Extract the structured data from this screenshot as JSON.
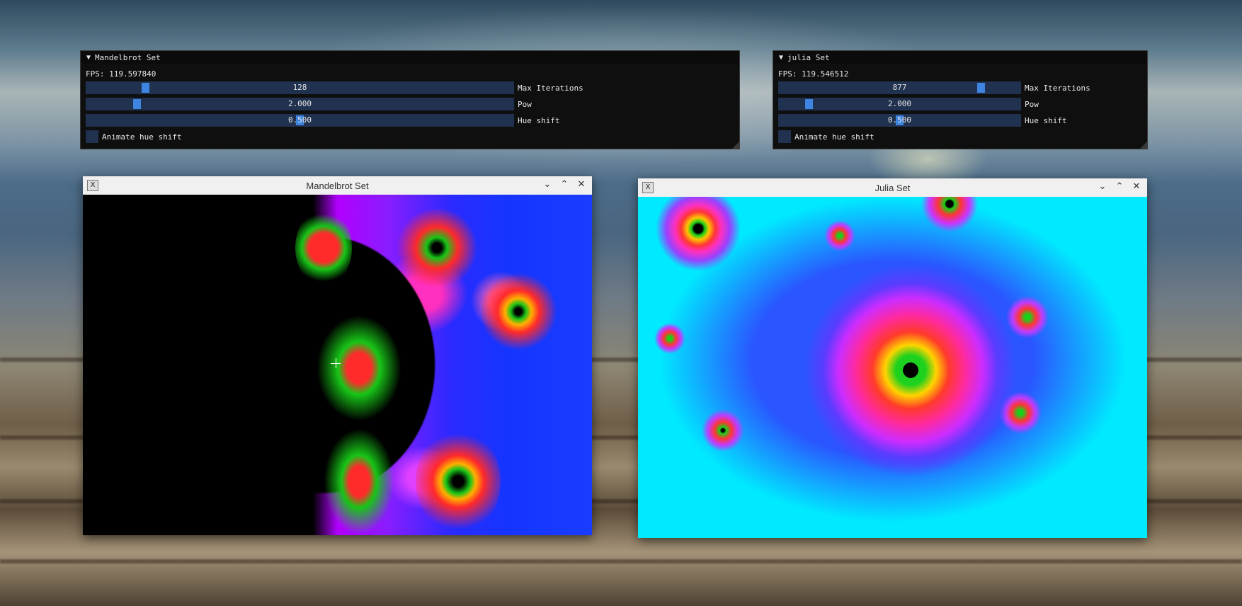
{
  "mandelbrot_panel": {
    "title": "Mandelbrot Set",
    "fps_text": "FPS: 119.597840",
    "sliders": [
      {
        "value_text": "128",
        "label": "Max Iterations",
        "fraction": 0.13
      },
      {
        "value_text": "2.000",
        "label": "Pow",
        "fraction": 0.11
      },
      {
        "value_text": "0.500",
        "label": "Hue shift",
        "fraction": 0.5
      }
    ],
    "checkbox_label": "Animate hue shift",
    "checkbox_checked": false
  },
  "julia_panel": {
    "title": "julia Set",
    "fps_text": "FPS: 119.546512",
    "sliders": [
      {
        "value_text": "877",
        "label": "Max Iterations",
        "fraction": 0.85
      },
      {
        "value_text": "2.000",
        "label": "Pow",
        "fraction": 0.11
      },
      {
        "value_text": "0.500",
        "label": "Hue shift",
        "fraction": 0.5
      }
    ],
    "checkbox_label": "Animate hue shift",
    "checkbox_checked": false
  },
  "mandelbrot_window": {
    "title": "Mandelbrot Set",
    "app_icon": "x-window-icon",
    "controls": [
      "minimize-icon",
      "maximize-icon",
      "close-icon"
    ]
  },
  "julia_window": {
    "title": "Julia Set",
    "app_icon": "x-window-icon",
    "controls": [
      "minimize-icon",
      "maximize-icon",
      "close-icon"
    ]
  },
  "colors": {
    "imgui_bg": "#0f0f0f",
    "slider_bg": "#20324f",
    "slider_grab": "#3d85e0",
    "julia_bg": "#00eaff",
    "mandel_blue": "#1535ff"
  }
}
